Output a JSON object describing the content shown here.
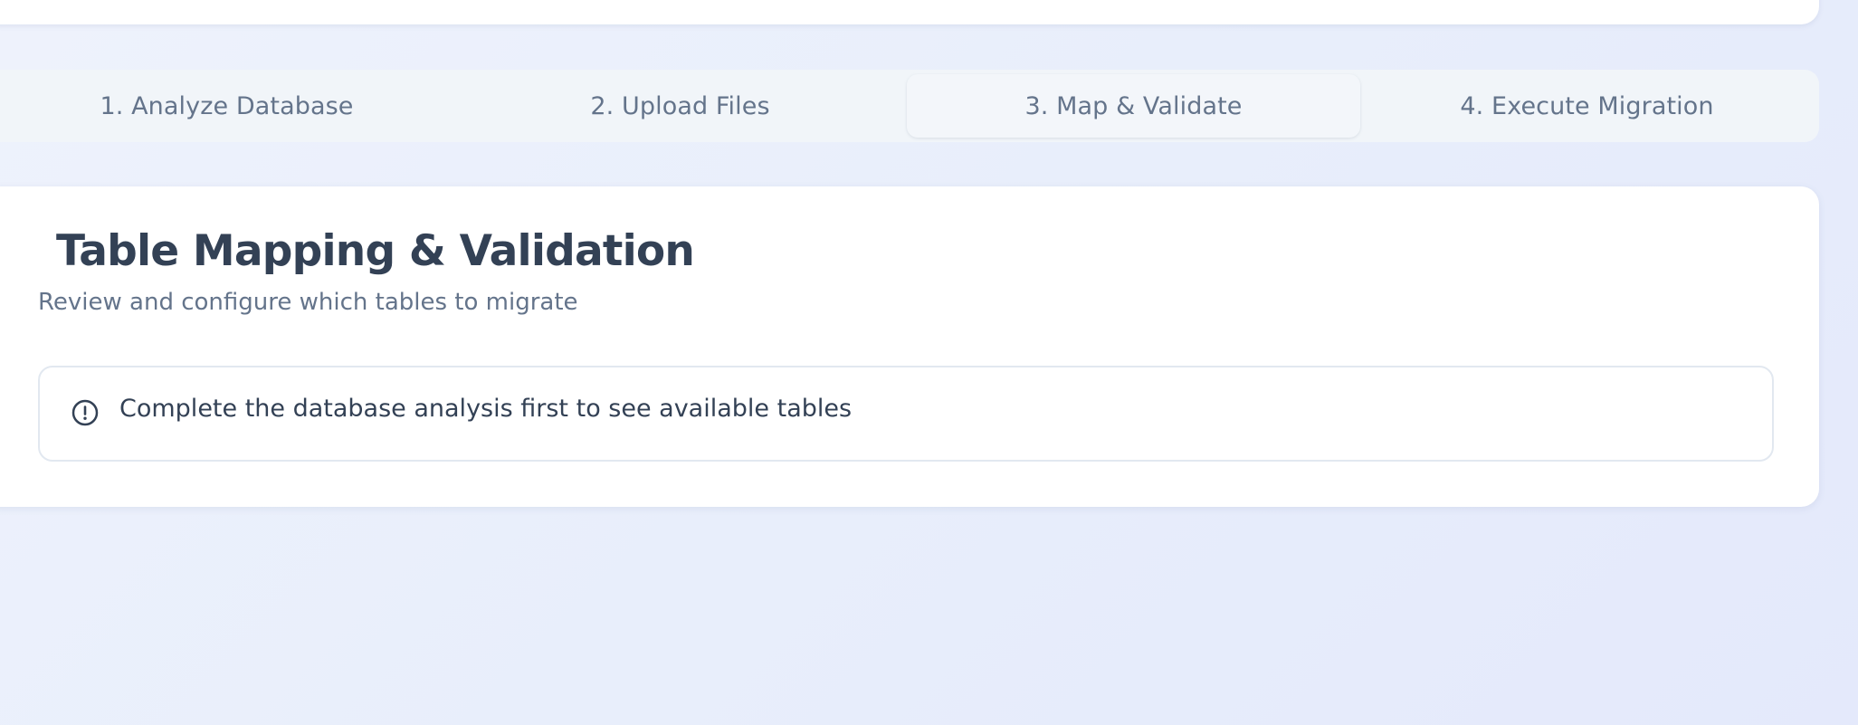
{
  "tabs": [
    {
      "label": "1. Analyze Database"
    },
    {
      "label": "2. Upload Files"
    },
    {
      "label": "3. Map & Validate"
    },
    {
      "label": "4. Execute Migration"
    }
  ],
  "active_tab": "3. Map & Validate",
  "section": {
    "title": "Table Mapping & Validation",
    "subtitle": "Review and configure which tables to migrate"
  },
  "alert": {
    "icon": "alert-circle-icon",
    "message": "Complete the database analysis first to see available tables"
  },
  "colors": {
    "background": "#e8eefb",
    "card": "#ffffff",
    "tabs_bar": "#f1f5f9",
    "heading": "#334155",
    "muted": "#64748b",
    "border": "#e2e8f0"
  }
}
